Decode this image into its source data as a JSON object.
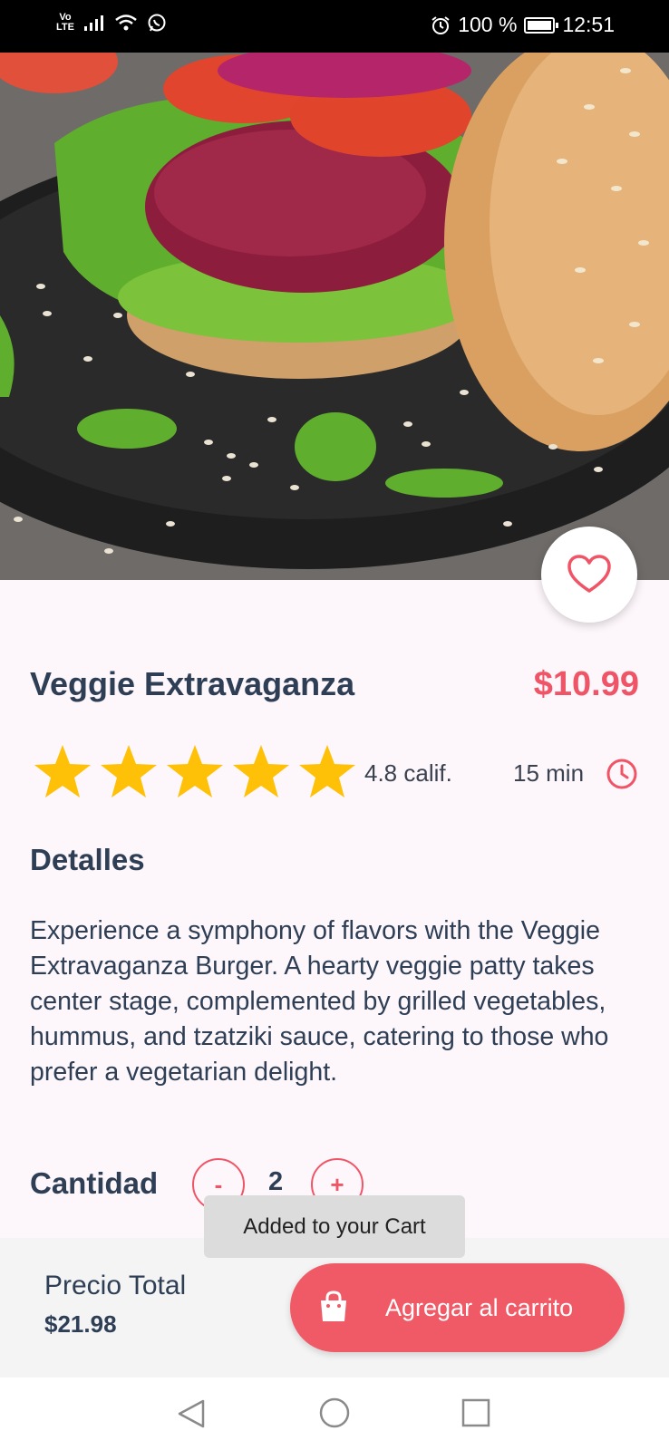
{
  "status_bar": {
    "volte_top": "Vo",
    "volte_bottom": "LTE",
    "battery_text": "100 %",
    "time": "12:51",
    "icons": [
      "signal-icon",
      "wifi-icon",
      "whatsapp-icon",
      "alarm-icon",
      "battery-icon"
    ]
  },
  "hero": {
    "image": "veggie-burger-photo"
  },
  "product": {
    "name": "Veggie Extravaganza",
    "price": "$10.99",
    "stars_filled": 5,
    "stars_total": 5,
    "rating_text": "4.8 calif.",
    "time_text": "15 min"
  },
  "details": {
    "heading": "Detalles",
    "description": "Experience a symphony of flavors with the Veggie Extravaganza Burger. A hearty veggie patty takes center stage, complemented by grilled vegetables, hummus, and tzatziki sauce, catering to those who prefer a vegetarian delight."
  },
  "quantity": {
    "label": "Cantidad",
    "minus": "-",
    "value": "2",
    "plus": "+"
  },
  "footer": {
    "total_label": "Precio Total",
    "total_value": "$21.98",
    "cart_button": "Agregar al carrito"
  },
  "toast": {
    "message": "Added to your Cart"
  },
  "colors": {
    "accent": "#ef5566",
    "text_dark": "#2d3e55",
    "star": "#ffc107",
    "background": "#fdf6fb"
  }
}
